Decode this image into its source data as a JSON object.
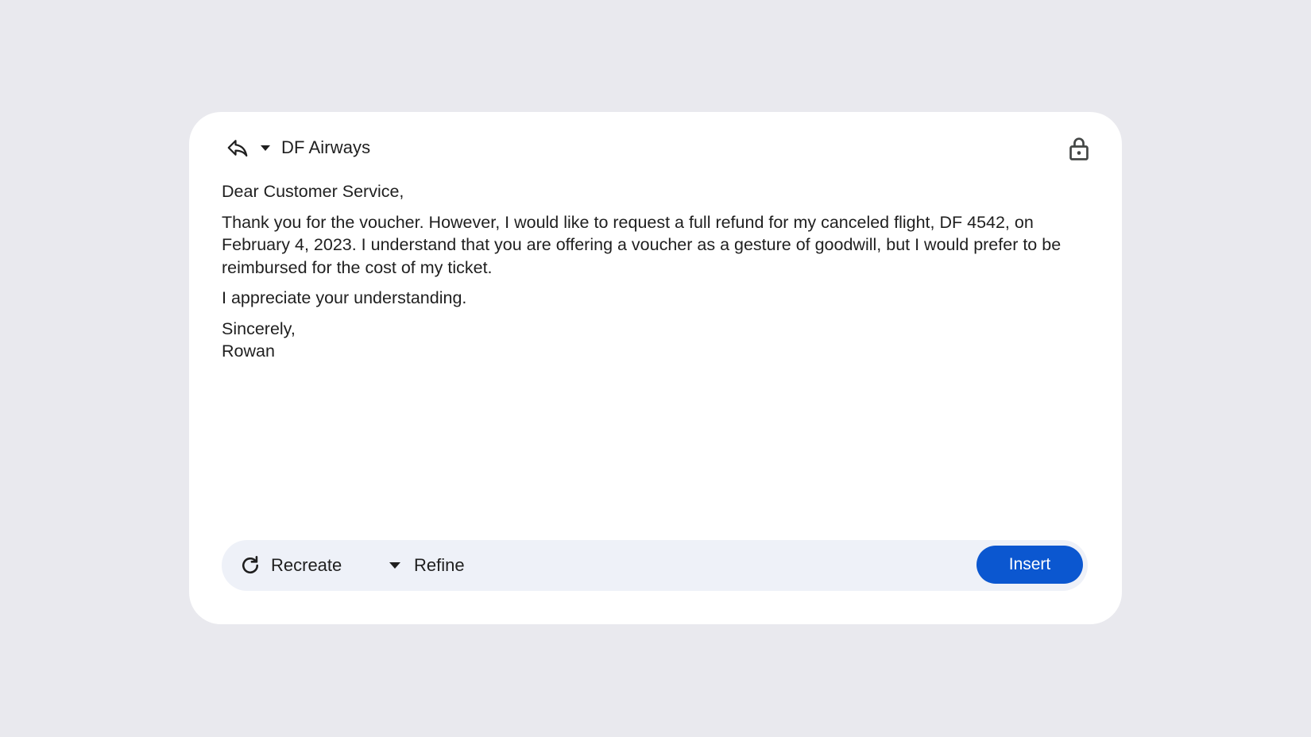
{
  "header": {
    "reply_icon": "reply-icon",
    "dropdown_icon": "arrow-drop-down-icon",
    "recipient": "DF Airways",
    "lock_icon": "lock-icon"
  },
  "draft": {
    "greeting": "Dear Customer Service,",
    "paragraph1": "Thank you for the voucher. However, I would like to request a full refund for my canceled flight, DF 4542, on February 4, 2023. I understand that you are offering a voucher as a gesture of goodwill, but I would prefer to be reimbursed for the cost of my ticket.",
    "paragraph2": "I appreciate your understanding.",
    "closing": "Sincerely,",
    "signature": "Rowan"
  },
  "toolbar": {
    "recreate_label": "Recreate",
    "recreate_icon": "refresh-icon",
    "refine_label": "Refine",
    "refine_icon": "arrow-drop-down-icon",
    "insert_label": "Insert"
  },
  "colors": {
    "background": "#e9e9ee",
    "card": "#ffffff",
    "toolbar": "#eef1f8",
    "accent": "#0b57d0",
    "text": "#1f1f1f"
  }
}
